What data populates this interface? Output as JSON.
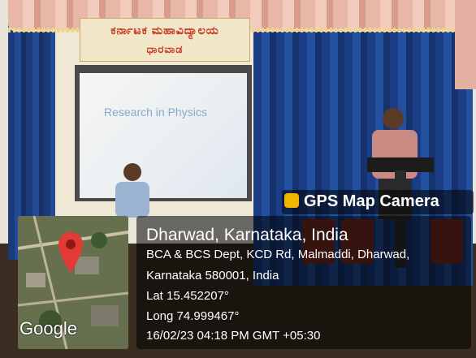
{
  "banner": {
    "line1": "ಕರ್ನಾಟಕ ಮಹಾವಿದ್ಯಾಲಯ",
    "line2": "ಧಾರವಾಡ"
  },
  "slide": {
    "title": "Research in Physics"
  },
  "map": {
    "logo_text": "Google",
    "pin_color": "#e53935"
  },
  "gps_overlay": {
    "app_name": "GPS Map Camera",
    "icon": "camera-pin-icon",
    "location": "Dharwad, Karnataka, India",
    "address_line1": "BCA & BCS Dept, KCD Rd, Malmaddi, Dharwad,",
    "address_line2": "Karnataka 580001, India",
    "latitude": "Lat 15.452207°",
    "longitude": "Long 74.999467°",
    "timestamp": "16/02/23 04:18 PM GMT +05:30"
  },
  "colors": {
    "curtain": "#1f4690",
    "valance": "#e7b7a8",
    "banner_text": "#c4341f",
    "overlay_bg": "rgba(0,0,0,0.55)"
  }
}
